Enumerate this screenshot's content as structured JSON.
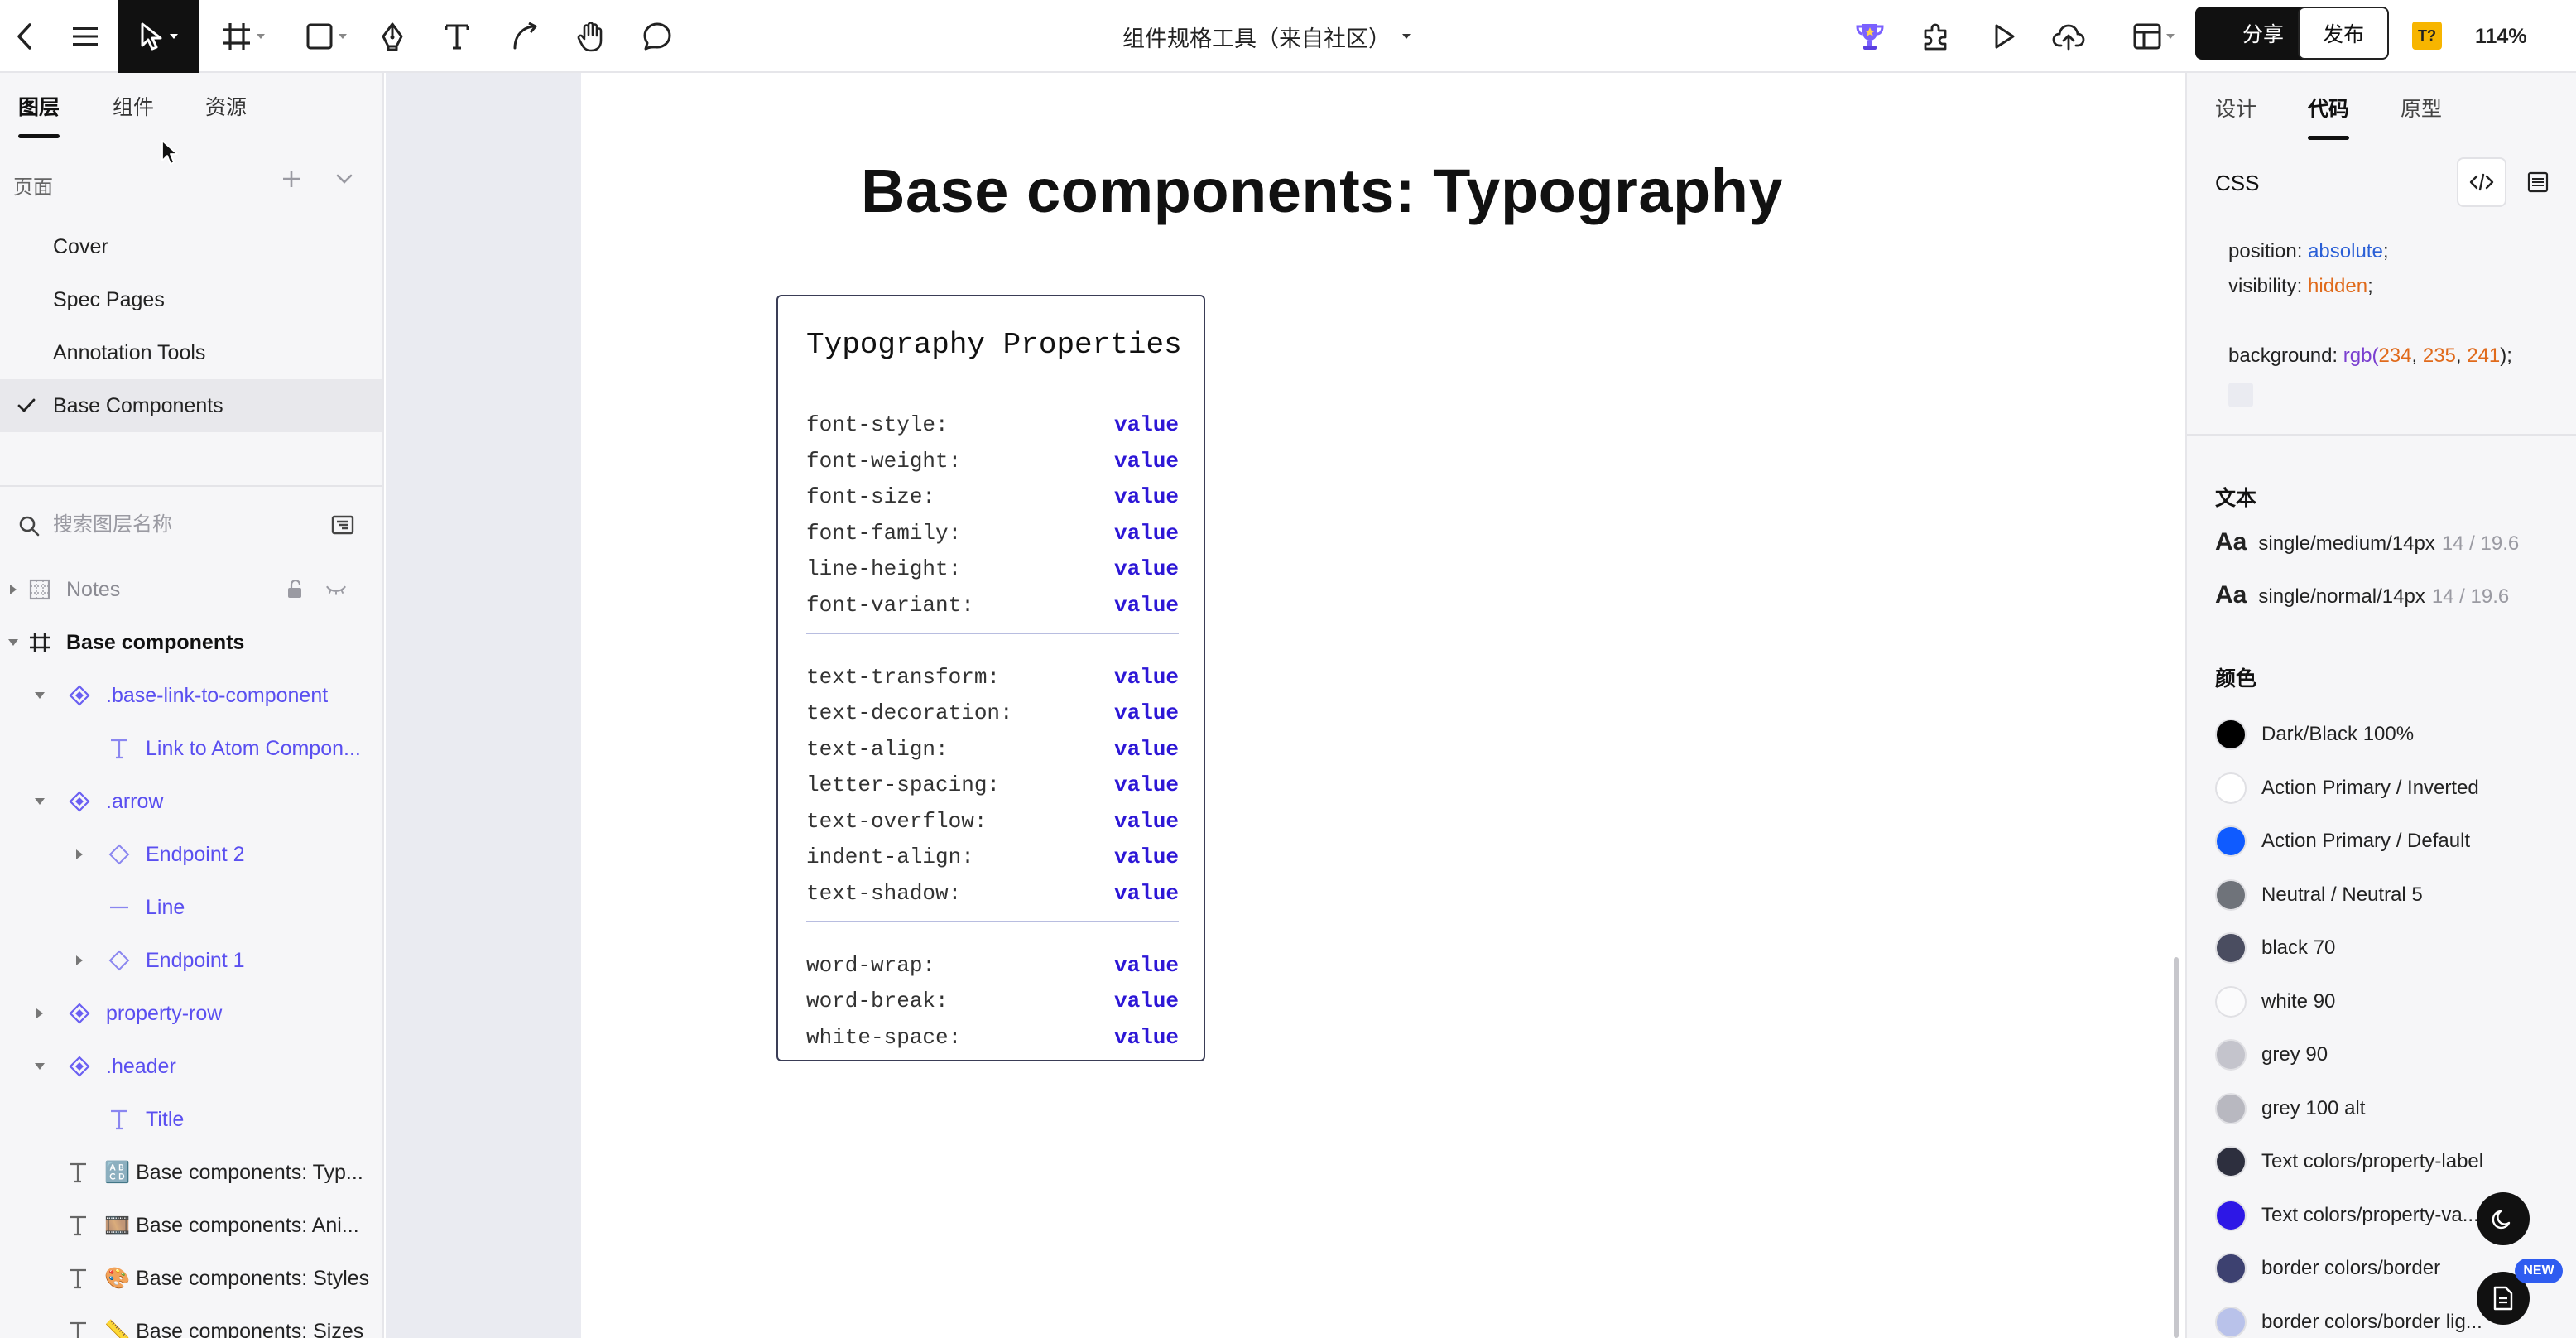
{
  "topbar": {
    "doc_title": "组件规格工具（来自社区）",
    "share_label": "分享",
    "publish_label": "发布",
    "zoom": "114%",
    "plugin_badge": "T?"
  },
  "left_panel": {
    "tabs": [
      {
        "label": "图层",
        "active": true
      },
      {
        "label": "组件",
        "active": false
      },
      {
        "label": "资源",
        "active": false
      }
    ],
    "pages_header": "页面",
    "pages": [
      {
        "label": "Cover",
        "active": false
      },
      {
        "label": "Spec Pages",
        "active": false
      },
      {
        "label": "Annotation Tools",
        "active": false
      },
      {
        "label": "Base Components",
        "active": true
      }
    ],
    "search_placeholder": "搜索图层名称",
    "layers": [
      {
        "label": "Notes",
        "icon": "frame-grid-icon"
      },
      {
        "label": "Base components",
        "icon": "frame-icon"
      },
      {
        "label": ".base-link-to-component",
        "icon": "component-icon"
      },
      {
        "label": "Link to Atom Compon...",
        "icon": "text-icon"
      },
      {
        "label": ".arrow",
        "icon": "component-icon"
      },
      {
        "label": "Endpoint 2",
        "icon": "instance-icon"
      },
      {
        "label": "Line",
        "icon": "line-icon"
      },
      {
        "label": "Endpoint 1",
        "icon": "instance-icon"
      },
      {
        "label": "property-row",
        "icon": "component-icon"
      },
      {
        "label": ".header",
        "icon": "component-icon"
      },
      {
        "label": "Title",
        "icon": "text-icon"
      },
      {
        "label": "🔠 Base components: Typ...",
        "icon": "text-icon"
      },
      {
        "label": "🎞️ Base components: Ani...",
        "icon": "text-icon"
      },
      {
        "label": "🎨 Base components: Styles",
        "icon": "text-icon"
      },
      {
        "label": "📏 Base components: Sizes",
        "icon": "text-icon"
      }
    ]
  },
  "canvas": {
    "title": "Base components: Typography",
    "card": {
      "heading": "Typography Properties",
      "groups": [
        [
          {
            "name": "font-style:",
            "value": "value"
          },
          {
            "name": "font-weight:",
            "value": "value"
          },
          {
            "name": "font-size:",
            "value": "value"
          },
          {
            "name": "font-family:",
            "value": "value"
          },
          {
            "name": "line-height:",
            "value": "value"
          },
          {
            "name": "font-variant:",
            "value": "value"
          }
        ],
        [
          {
            "name": "text-transform:",
            "value": "value"
          },
          {
            "name": "text-decoration:",
            "value": "value"
          },
          {
            "name": "text-align:",
            "value": "value"
          },
          {
            "name": "letter-spacing:",
            "value": "value"
          },
          {
            "name": "text-overflow:",
            "value": "value"
          },
          {
            "name": "indent-align:",
            "value": "value"
          },
          {
            "name": "text-shadow:",
            "value": "value"
          }
        ],
        [
          {
            "name": "word-wrap:",
            "value": "value"
          },
          {
            "name": "word-break:",
            "value": "value"
          },
          {
            "name": "white-space:",
            "value": "value"
          }
        ]
      ]
    }
  },
  "right_panel": {
    "tabs": [
      {
        "label": "设计",
        "active": false
      },
      {
        "label": "代码",
        "active": true
      },
      {
        "label": "原型",
        "active": false
      }
    ],
    "css_label": "CSS",
    "css": {
      "position_prop": "position: ",
      "position_val": "absolute",
      "visibility_prop": "visibility: ",
      "visibility_val": "hidden",
      "background_prop": "background: ",
      "background_fn": "rgb(",
      "r": "234",
      "g": "235",
      "b": "241",
      "close": ");",
      "semi": ";",
      "comma": ", "
    },
    "text_section": "文本",
    "text_styles": [
      {
        "aa": "Aa",
        "name": "single/medium/14px",
        "meta": "14 / 19.6"
      },
      {
        "aa": "Aa",
        "name": "single/normal/14px",
        "meta": "14 / 19.6"
      }
    ],
    "color_section": "颜色",
    "colors": [
      {
        "name": "Dark/Black 100%",
        "hex": "#000000"
      },
      {
        "name": "Action Primary / Inverted",
        "hex": "#ffffff"
      },
      {
        "name": "Action Primary / Default",
        "hex": "#0f5bff"
      },
      {
        "name": "Neutral / Neutral 5",
        "hex": "#6f737a"
      },
      {
        "name": "black 70",
        "hex": "#4a4d60"
      },
      {
        "name": "white 90",
        "hex": "#fbfbfc"
      },
      {
        "name": "grey 90",
        "hex": "#c4c4cc"
      },
      {
        "name": "grey 100 alt",
        "hex": "#b8b8c0"
      },
      {
        "name": "Text colors/property-label",
        "hex": "#2d2f3e"
      },
      {
        "name": "Text colors/property-va...",
        "hex": "#2d17e6"
      },
      {
        "name": "border colors/border",
        "hex": "#3d4170"
      },
      {
        "name": "border colors/border lig...",
        "hex": "#b9c2ea"
      }
    ],
    "new_badge": "NEW"
  }
}
